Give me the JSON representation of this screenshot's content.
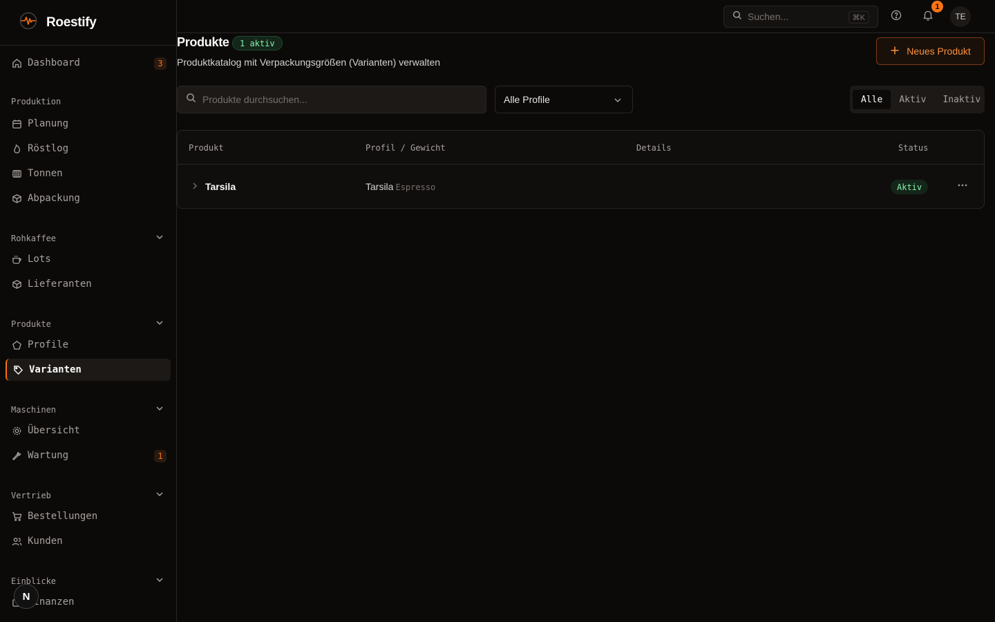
{
  "app": {
    "name": "Roestify"
  },
  "sidebar": {
    "dashboard": {
      "label": "Dashboard",
      "badge": "3"
    },
    "sections": [
      {
        "label": "Produktion",
        "items": [
          {
            "label": "Planung"
          },
          {
            "label": "Röstlog"
          },
          {
            "label": "Tonnen"
          },
          {
            "label": "Abpackung"
          }
        ]
      },
      {
        "label": "Rohkaffee",
        "items": [
          {
            "label": "Lots"
          },
          {
            "label": "Lieferanten"
          }
        ]
      },
      {
        "label": "Produkte",
        "items": [
          {
            "label": "Profile"
          },
          {
            "label": "Varianten"
          }
        ]
      },
      {
        "label": "Maschinen",
        "items": [
          {
            "label": "Übersicht"
          },
          {
            "label": "Wartung",
            "badge": "1"
          }
        ]
      },
      {
        "label": "Vertrieb",
        "items": [
          {
            "label": "Bestellungen"
          },
          {
            "label": "Kunden"
          }
        ]
      },
      {
        "label": "Einblicke",
        "items": [
          {
            "label": "Finanzen"
          }
        ]
      }
    ],
    "floating_avatar": "N"
  },
  "topbar": {
    "search_placeholder": "Suchen...",
    "shortcut": "⌘K",
    "notification_count": "1",
    "user_initials": "TE"
  },
  "page": {
    "title": "Produkte",
    "active_count": "1 aktiv",
    "subtitle": "Produktkatalog mit Verpackungsgrößen (Varianten) verwalten",
    "new_button": "Neues Produkt",
    "search_placeholder": "Produkte durchsuchen...",
    "profile_filter": "Alle Profile",
    "status_filters": [
      "Alle",
      "Aktiv",
      "Inaktiv"
    ],
    "selected_status_filter": "Alle"
  },
  "table": {
    "columns": [
      "Produkt",
      "Profil / Gewicht",
      "Details",
      "Status"
    ],
    "rows": [
      {
        "product": "Tarsila",
        "profile": "Tarsila",
        "profile_type": "Espresso",
        "details": "",
        "status": "Aktiv"
      }
    ]
  },
  "colors": {
    "accent": "#f97316",
    "success": "#86efac",
    "background": "#0c0a09"
  }
}
